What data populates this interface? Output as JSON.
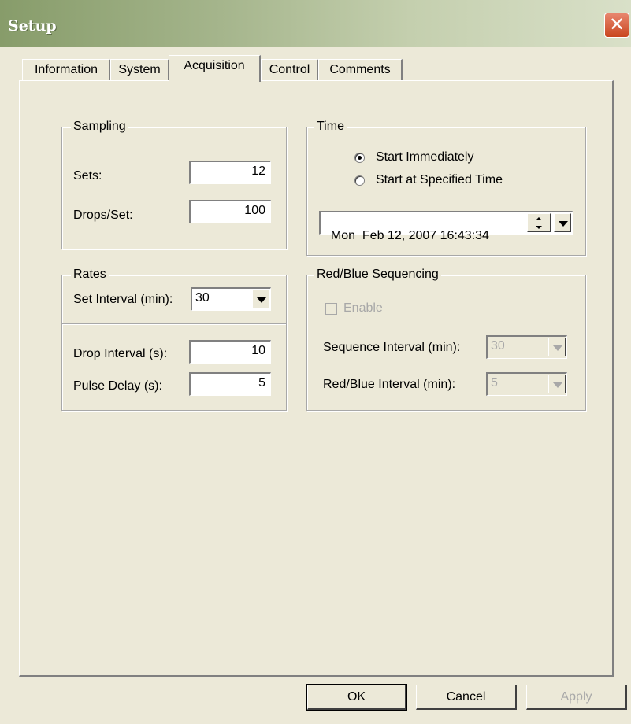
{
  "window": {
    "title": "Setup",
    "close_glyph": "✕"
  },
  "tabs": [
    {
      "label": "Information"
    },
    {
      "label": "System"
    },
    {
      "label": "Acquisition",
      "active": true
    },
    {
      "label": "Control"
    },
    {
      "label": "Comments"
    }
  ],
  "sampling": {
    "group_label": "Sampling",
    "sets_label": "Sets:",
    "sets_value": "12",
    "drops_label": "Drops/Set:",
    "drops_value": "100"
  },
  "time": {
    "group_label": "Time",
    "start_immediately_label": "Start Immediately",
    "start_immediately_selected": true,
    "start_specified_label": "Start at Specified Time",
    "start_specified_selected": false,
    "datetime_value": "Mon  Feb 12, 2007 16:43:34"
  },
  "rates": {
    "group_label": "Rates",
    "set_interval_label": "Set Interval (min):",
    "set_interval_value": "30",
    "drop_interval_label": "Drop Interval (s):",
    "drop_interval_value": "10",
    "pulse_delay_label": "Pulse Delay (s):",
    "pulse_delay_value": "5"
  },
  "red_blue": {
    "group_label": "Red/Blue Sequencing",
    "enable_label": "Enable",
    "enable_checked": false,
    "sequence_interval_label": "Sequence Interval (min):",
    "sequence_interval_value": "30",
    "red_blue_interval_label": "Red/Blue Interval (min):",
    "red_blue_interval_value": "5"
  },
  "buttons": {
    "ok_label": "OK",
    "cancel_label": "Cancel",
    "apply_label": "Apply"
  },
  "colors": {
    "dialog_bg": "#ece9d8",
    "disabled_text": "#a8a8a8",
    "close_button": "#c9461f"
  }
}
